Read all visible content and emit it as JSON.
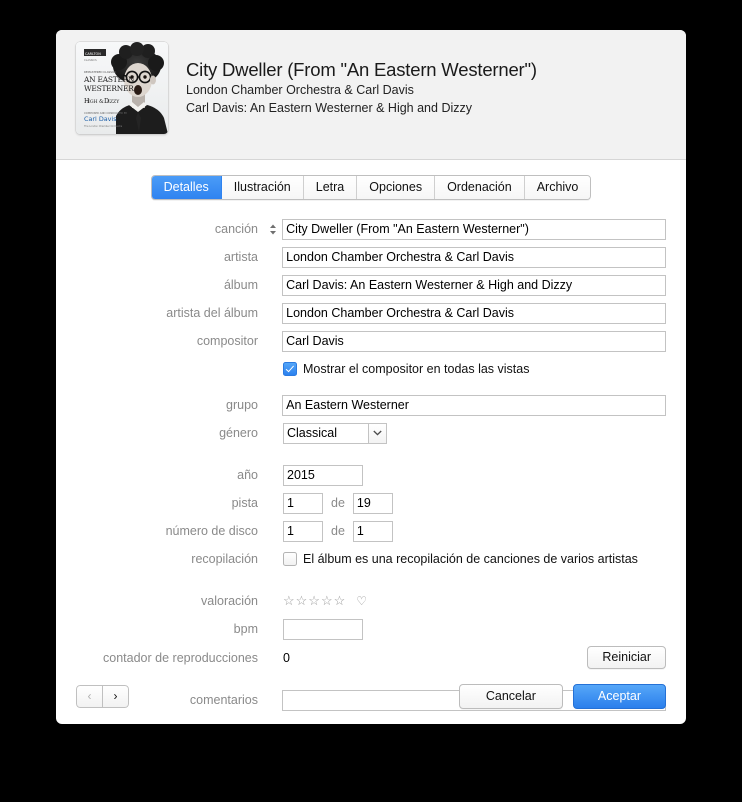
{
  "header": {
    "title": "City Dweller (From \"An Eastern Westerner\")",
    "artist": "London Chamber Orchestra & Carl Davis",
    "album": "Carl Davis: An Eastern Westerner & High and Dizzy",
    "artwork": {
      "label_top": "CARLTON",
      "line1": "AN EASTERN",
      "line2": "WESTERNER",
      "line3": "HIGH & DIZZY",
      "credit": "Carl Davis"
    }
  },
  "tabs": [
    {
      "label": "Detalles",
      "active": true
    },
    {
      "label": "Ilustración",
      "active": false
    },
    {
      "label": "Letra",
      "active": false
    },
    {
      "label": "Opciones",
      "active": false
    },
    {
      "label": "Ordenación",
      "active": false
    },
    {
      "label": "Archivo",
      "active": false
    }
  ],
  "fields": {
    "song": {
      "label": "canción",
      "value": "City Dweller (From \"An Eastern Westerner\")"
    },
    "artist": {
      "label": "artista",
      "value": "London Chamber Orchestra & Carl Davis"
    },
    "album": {
      "label": "álbum",
      "value": "Carl Davis: An Eastern Westerner & High and Dizzy"
    },
    "album_artist": {
      "label": "artista del álbum",
      "value": "London Chamber Orchestra & Carl Davis"
    },
    "composer": {
      "label": "compositor",
      "value": "Carl Davis"
    },
    "show_composer": {
      "label": "Mostrar el compositor en todas las vistas",
      "checked": true
    },
    "grouping": {
      "label": "grupo",
      "value": "An Eastern Westerner"
    },
    "genre": {
      "label": "género",
      "value": "Classical"
    },
    "year": {
      "label": "año",
      "value": "2015"
    },
    "track": {
      "label": "pista",
      "number": "1",
      "of_label": "de",
      "total": "19"
    },
    "disc": {
      "label": "número de disco",
      "number": "1",
      "of_label": "de",
      "total": "1"
    },
    "compilation": {
      "label": "recopilación",
      "text": "El álbum es una recopilación de canciones de varios artistas",
      "checked": false
    },
    "rating": {
      "label": "valoración",
      "stars": "☆☆☆☆☆",
      "heart": "♡"
    },
    "bpm": {
      "label": "bpm",
      "value": ""
    },
    "play_count": {
      "label": "contador de reproducciones",
      "value": "0",
      "reset_button": "Reiniciar"
    },
    "comments": {
      "label": "comentarios",
      "value": ""
    }
  },
  "footer": {
    "prev_icon": "‹",
    "next_icon": "›",
    "cancel": "Cancelar",
    "accept": "Aceptar"
  },
  "colors": {
    "accent": "#2b7fec",
    "label": "#8a8a8a",
    "header_bg": "#f2f2f2"
  }
}
